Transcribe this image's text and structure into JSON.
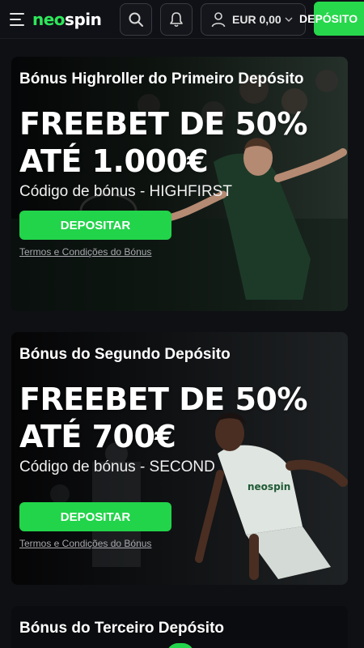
{
  "header": {
    "logo_neo": "neo",
    "logo_spin": "spin",
    "balance": "EUR 0,00",
    "deposit_label": "DEPÓSITO",
    "icons": [
      "menu-icon",
      "search-icon",
      "bell-icon",
      "user-icon",
      "chevron-down-icon"
    ],
    "accent_color": "#27d84c"
  },
  "promos": [
    {
      "title": "Bónus Highroller do Primeiro Depósito",
      "headline_line1": "FREEBET DE 50%",
      "headline_line2": "ATÉ 1.000€",
      "code_text": "Código de bónus - HIGHFIRST",
      "cta_label": "DEPOSITAR",
      "terms_label": "Termos e Condições do Bónus"
    },
    {
      "title": "Bónus do Segundo Depósito",
      "headline_line1": "FREEBET DE 50%",
      "headline_line2": "ATÉ 700€",
      "code_text": "Código de bónus - SECOND",
      "cta_label": "DEPOSITAR",
      "terms_label": "Termos e Condições do Bónus"
    },
    {
      "title": "Bónus do Terceiro Depósito"
    }
  ]
}
